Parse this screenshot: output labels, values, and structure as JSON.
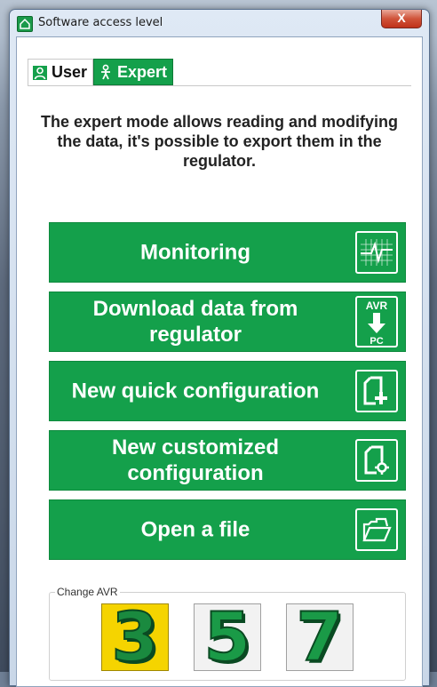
{
  "window": {
    "title": "Software access level",
    "close_glyph": "X"
  },
  "tabs": [
    {
      "label": "User",
      "icon": "user-icon",
      "active": false
    },
    {
      "label": "Expert",
      "icon": "expert-icon",
      "active": true
    }
  ],
  "description": "The expert mode allows reading and modifying the data, it's possible to export them in the regulator.",
  "buttons": [
    {
      "label": "Monitoring",
      "icon": "monitoring-chart-icon"
    },
    {
      "label": "Download data from regulator",
      "icon": "avr-to-pc-download-icon",
      "icon_text_top": "AVR",
      "icon_text_bottom": "PC"
    },
    {
      "label": "New quick configuration",
      "icon": "new-document-plus-icon"
    },
    {
      "label": "New customized configuration",
      "icon": "document-gear-icon"
    },
    {
      "label": "Open a file",
      "icon": "open-folder-icon"
    }
  ],
  "avr": {
    "group_label": "Change AVR",
    "options": [
      {
        "digit": "3",
        "selected": true
      },
      {
        "digit": "5",
        "selected": false
      },
      {
        "digit": "7",
        "selected": false
      }
    ]
  },
  "colors": {
    "accent_green": "#14a04b",
    "selected_yellow": "#f5d400"
  }
}
